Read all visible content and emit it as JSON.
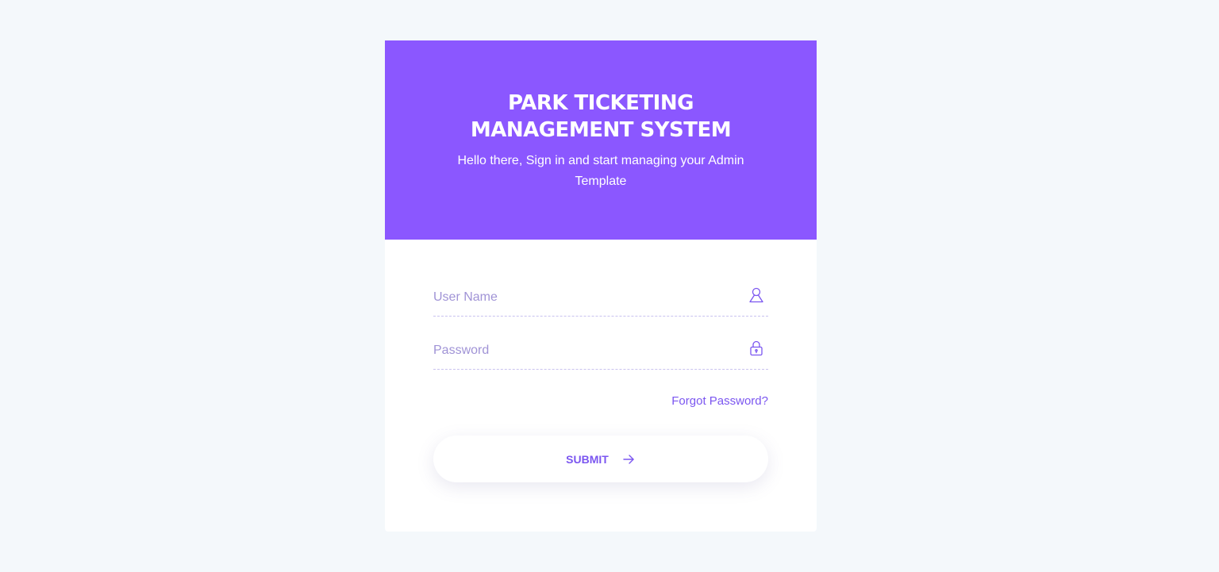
{
  "header": {
    "title_line1": "PARK TICKETING",
    "title_line2": "MANAGEMENT SYSTEM",
    "subtitle": "Hello there, Sign in and start managing your Admin Template"
  },
  "form": {
    "username_placeholder": "User Name",
    "username_value": "",
    "username_icon": "user-icon",
    "password_placeholder": "Password",
    "password_value": "",
    "password_icon": "lock-icon",
    "forgot_label": "Forgot Password?",
    "submit_label": "SUBMIT",
    "submit_icon": "arrow-right-icon"
  },
  "colors": {
    "background": "#f4f8fb",
    "header": "#8b57ff",
    "accent": "#7b56f0",
    "placeholder": "#a093d6"
  }
}
